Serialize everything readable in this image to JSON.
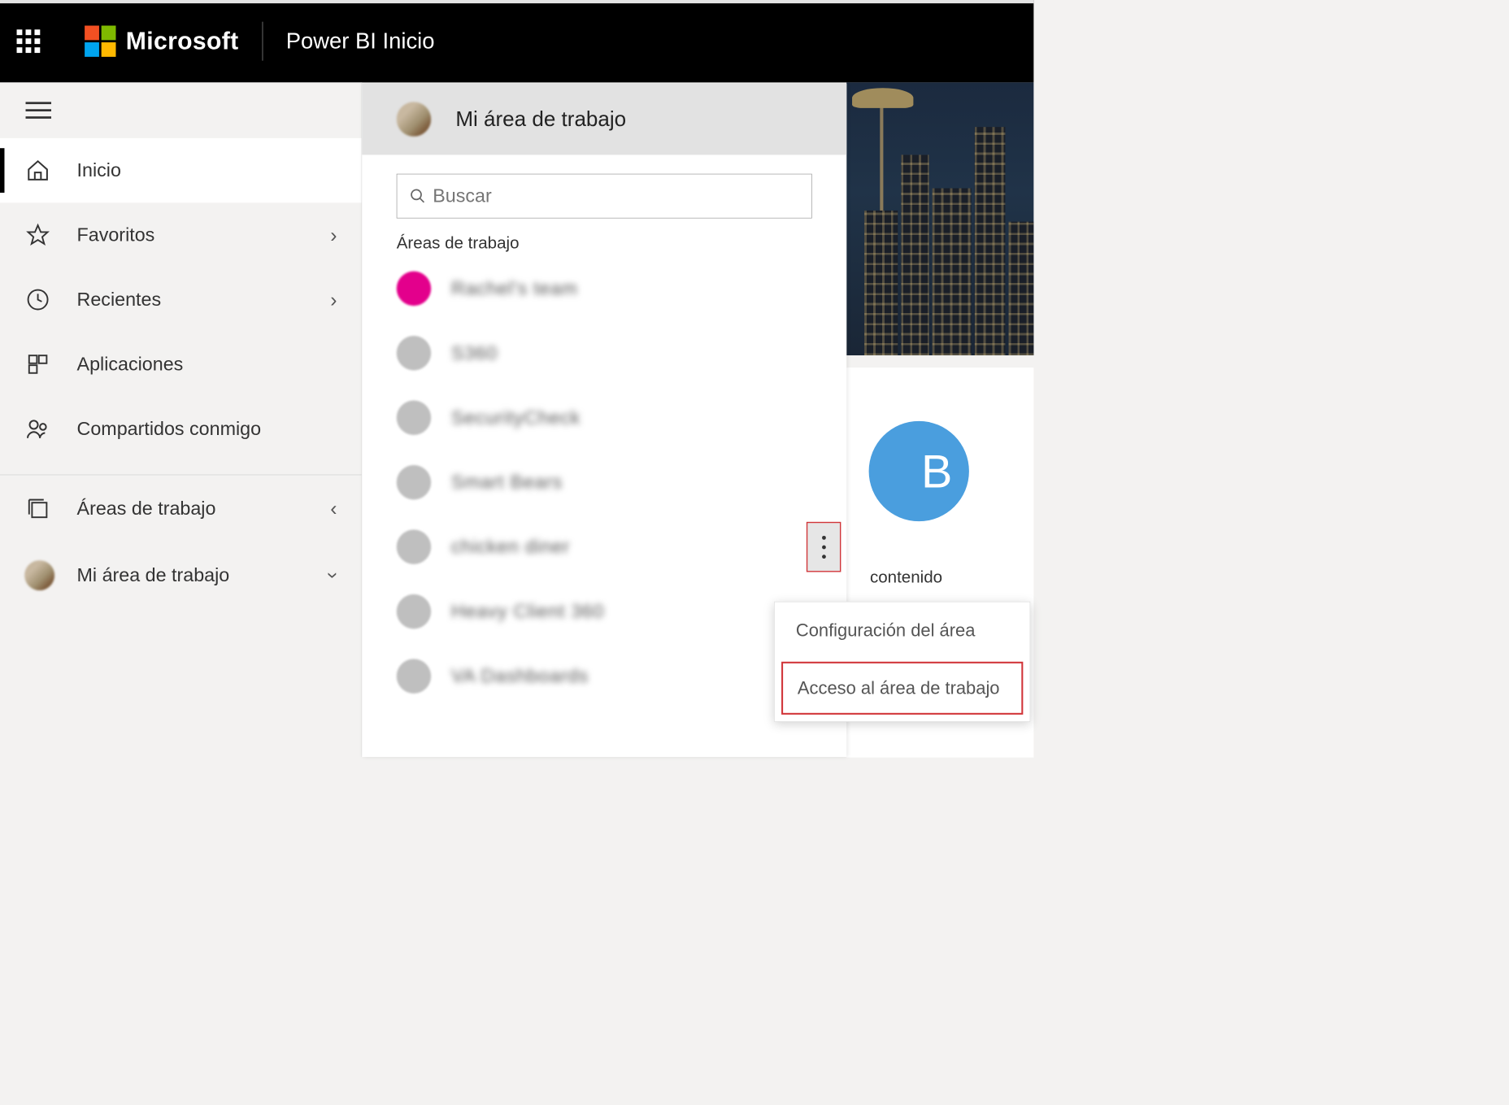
{
  "header": {
    "brand": "Microsoft",
    "app_title": "Power BI Inicio"
  },
  "nav": {
    "items": [
      {
        "key": "home",
        "label": "Inicio",
        "has_chevron": false,
        "selected": true
      },
      {
        "key": "favorites",
        "label": "Favoritos",
        "has_chevron": true,
        "selected": false
      },
      {
        "key": "recent",
        "label": "Recientes",
        "has_chevron": true,
        "selected": false
      },
      {
        "key": "apps",
        "label": "Aplicaciones",
        "has_chevron": false,
        "selected": false
      },
      {
        "key": "shared",
        "label": "Compartidos conmigo",
        "has_chevron": false,
        "selected": false
      }
    ],
    "lower": [
      {
        "key": "workspaces",
        "label": "Áreas de trabajo",
        "chevron": "left"
      },
      {
        "key": "myworkspace",
        "label": "Mi área de trabajo",
        "chevron": "down"
      }
    ]
  },
  "flyout": {
    "header_title": "Mi área de trabajo",
    "search_placeholder": "Buscar",
    "section_label": "Áreas de trabajo",
    "items": [
      {
        "label": "Rachel's team",
        "color": "magenta"
      },
      {
        "label": "S360",
        "color": "gray"
      },
      {
        "label": "SecurityCheck",
        "color": "gray"
      },
      {
        "label": "Smart Bears",
        "color": "gray"
      },
      {
        "label": "chicken diner",
        "color": "gray",
        "show_more": true
      },
      {
        "label": "Heavy Client 360",
        "color": "gray"
      },
      {
        "label": "VA Dashboards",
        "color": "gray"
      }
    ]
  },
  "right": {
    "circle_letter": "B",
    "contenido_label": "contenido"
  },
  "context_menu": {
    "item_settings": "Configuración del área",
    "item_access": "Acceso al área de trabajo"
  }
}
